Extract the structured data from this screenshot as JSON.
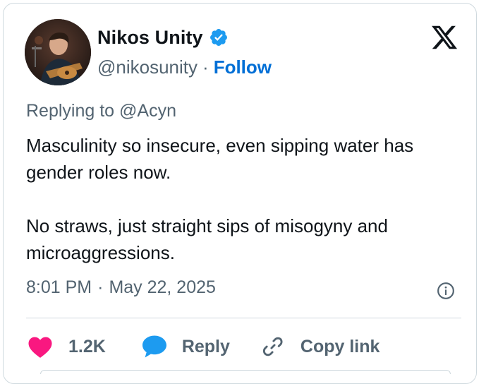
{
  "author": {
    "display_name": "Nikos Unity",
    "handle": "@nikosunity",
    "separator": "·",
    "follow_label": "Follow",
    "verified": true
  },
  "reply_context": {
    "prefix": "Replying to",
    "mention": "@Acyn"
  },
  "tweet": {
    "paragraphs": [
      "Masculinity so insecure, even sipping water has gender roles now.",
      "No straws, just straight sips of misogyny and microaggressions."
    ],
    "time": "8:01 PM",
    "separator": "·",
    "date": "May 22, 2025"
  },
  "actions": {
    "like_count": "1.2K",
    "reply_label": "Reply",
    "copy_label": "Copy link"
  },
  "colors": {
    "follow_blue": "#006fd6",
    "verified_blue": "#1d9bf0",
    "like_pink": "#f91880",
    "reply_blue": "#1d9bf0",
    "muted_text": "#536471",
    "primary_text": "#0f1419",
    "border": "#cfd9de"
  },
  "icons": {
    "platform_logo": "x-logo-icon",
    "verified": "verified-badge-icon",
    "info": "info-icon",
    "like": "heart-icon",
    "reply": "speech-bubble-icon",
    "copy": "link-icon"
  }
}
